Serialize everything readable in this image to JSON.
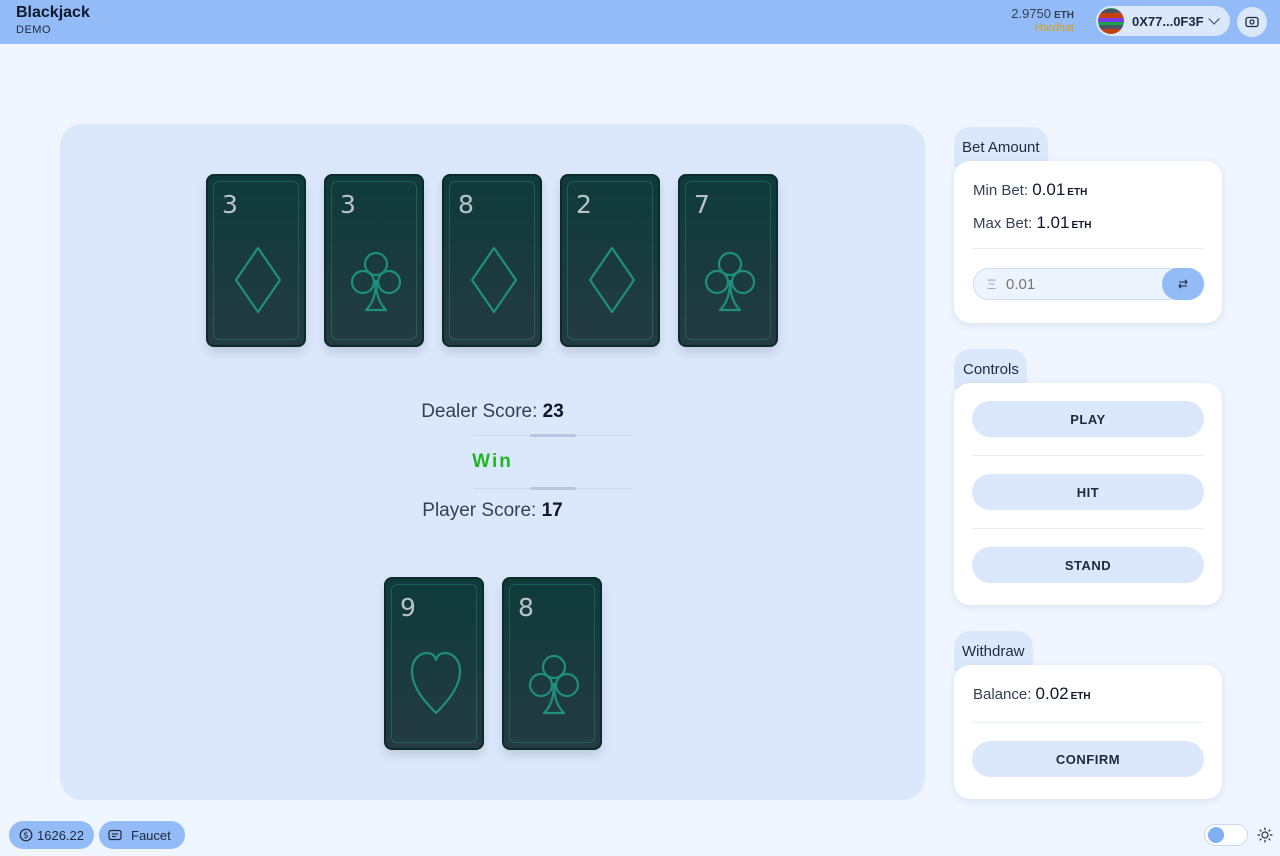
{
  "app": {
    "title": "Blackjack",
    "subtitle": "DEMO"
  },
  "wallet": {
    "balance": "2.9750",
    "unit": "ETH",
    "network": "Hardhat",
    "address": "0X77...0F3F"
  },
  "dealer": {
    "cards": [
      {
        "rank": "3",
        "suit": "diamond"
      },
      {
        "rank": "3",
        "suit": "club"
      },
      {
        "rank": "8",
        "suit": "diamond"
      },
      {
        "rank": "2",
        "suit": "diamond"
      },
      {
        "rank": "7",
        "suit": "club"
      }
    ],
    "score_label": "Dealer Score:",
    "score": "23"
  },
  "result": "Win",
  "player": {
    "cards": [
      {
        "rank": "9",
        "suit": "heart"
      },
      {
        "rank": "8",
        "suit": "club"
      }
    ],
    "score_label": "Player Score:",
    "score": "17"
  },
  "bet": {
    "title": "Bet Amount",
    "min_label": "Min Bet:",
    "min_value": "0.01",
    "min_unit": "ETH",
    "max_label": "Max Bet:",
    "max_value": "1.01",
    "max_unit": "ETH",
    "placeholder": "0.01",
    "currency_symbol": "Ξ"
  },
  "controls": {
    "title": "Controls",
    "play": "PLAY",
    "hit": "HIT",
    "stand": "STAND"
  },
  "withdraw": {
    "title": "Withdraw",
    "balance_label": "Balance:",
    "balance_value": "0.02",
    "balance_unit": "ETH",
    "confirm": "CONFIRM"
  },
  "footer": {
    "chip_balance": "1626.22",
    "faucet": "Faucet"
  },
  "colors": {
    "topbar": "#93bbf7",
    "table": "#dbe8fc",
    "card": "#0f3b3a",
    "win": "#22b422",
    "network": "#d4a017"
  },
  "icons": {
    "settings": "wallet-screen-icon",
    "chip": "dollar-circle-icon",
    "faucet": "faucet-icon",
    "theme": "sun-icon",
    "swap": "swap-arrows-icon"
  }
}
